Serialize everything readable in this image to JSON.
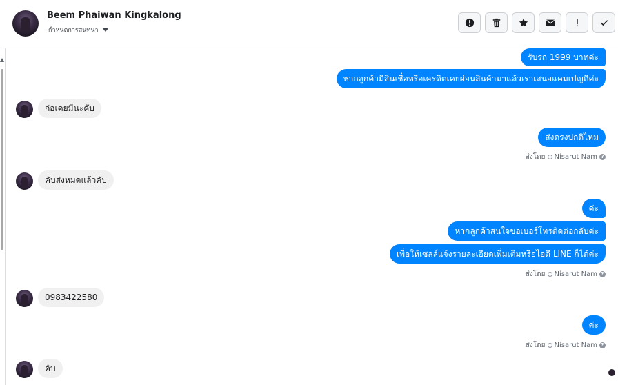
{
  "header": {
    "name": "Beem Phaiwan Kingkalong",
    "subtitle": "กำหนดการสนทนา"
  },
  "toolbar": {
    "buttons": [
      {
        "icon": "alert-circle-icon"
      },
      {
        "icon": "trash-icon"
      },
      {
        "icon": "star-icon"
      },
      {
        "icon": "envelope-icon"
      },
      {
        "icon": "exclamation-icon"
      },
      {
        "icon": "check-icon"
      }
    ]
  },
  "messages": {
    "m1_prefix": "รับรถ ",
    "m1_link": "1999 บาท",
    "m1_suffix": "ค่ะ",
    "m2": "หากลูกค้ามีสินเชื่อหรือเครดิตเคยผ่อนสินค้ามาแล้วเราเสนอแคมเปญดีค่ะ",
    "m3": "ก่อเคยมีนะคับ",
    "m4": "ส่งตรงปกติไหม",
    "m5": "คับส่งหมดแล้วคับ",
    "m6": "ค่ะ",
    "m7": "หากลูกค้าสนใจขอเบอร์โทรติดต่อกลับค่ะ",
    "m8": "เพื่อให้เซลล์แจ้งรายละเอียดเพิ่มเติมหรือไอดี LINE ก็ได้ค่ะ",
    "m9": "0983422580",
    "m10": "ค่ะ",
    "m11": "คับ"
  },
  "sent_by": {
    "label": "ส่งโดย",
    "agent": "Nisarut Nam",
    "help": "?"
  },
  "colors": {
    "outgoing": "#0084ff",
    "incoming": "#f1f0f0"
  }
}
